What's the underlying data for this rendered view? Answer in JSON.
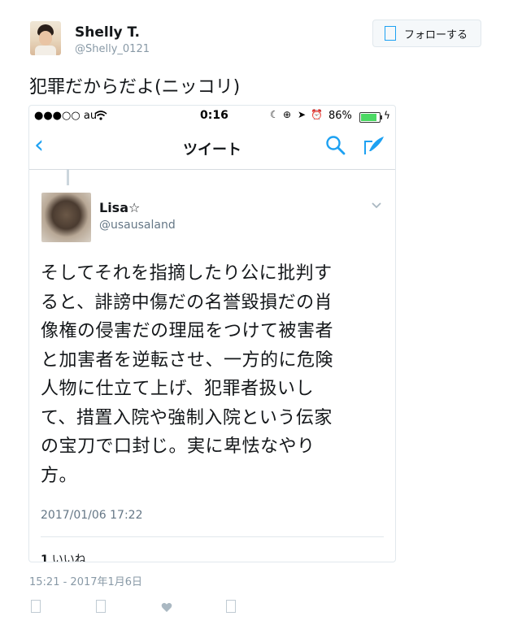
{
  "author": {
    "display_name": "Shelly T.",
    "handle": "@Shelly_0121"
  },
  "follow_button": {
    "label": "フォローする"
  },
  "tweet": {
    "text": "犯罪だからだよ(ニッコリ)",
    "timestamp": "15:21 - 2017年1月6日"
  },
  "screenshot": {
    "status_bar": {
      "carrier": "●●●○○ au",
      "time": "0:16",
      "battery": "86%",
      "battery_level": 0.86
    },
    "nav": {
      "title": "ツイート"
    },
    "quoted": {
      "display_name": "Lisa☆",
      "handle": "@usausaland",
      "lines": [
        "そしてそれを指摘したり公に批判す",
        "ると、誹謗中傷だの名誉毀損だの肖",
        "像権の侵害だの理屈をつけて被害者",
        "と加害者を逆転させ、一方的に危険",
        "人物に仕立て上げ、犯罪者扱いし",
        "て、措置入院や強制入院という伝家",
        "の宝刀で口封じ。実に卑怯なやり",
        "方。"
      ],
      "date": "2017/01/06 17:22",
      "like_count": "1",
      "like_label": "いいね"
    }
  },
  "colors": {
    "accent": "#1da1f2",
    "secondary_text": "#8899a6",
    "battery_green": "#4cd964"
  }
}
